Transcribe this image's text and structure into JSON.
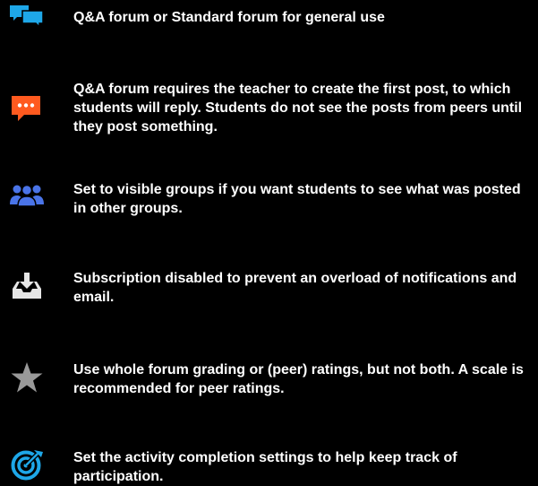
{
  "colors": {
    "background": "#000000",
    "text": "#ffffff",
    "icon_chat": "#1ea7e8",
    "icon_comment": "#ff5a1f",
    "icon_group": "#4a74e8",
    "icon_inbox": "#e6e6e6",
    "icon_star": "#999999",
    "icon_target": "#1ea7e8"
  },
  "items": [
    {
      "icon": "chat-bubbles-icon",
      "text": "Q&A forum or Standard forum for general use"
    },
    {
      "icon": "comment-dots-icon",
      "text": "Q&A forum requires the teacher to create the first post, to which students will reply. Students do not see the posts from peers until they post something."
    },
    {
      "icon": "users-group-icon",
      "text": "Set to visible groups if you want students to see what was posted in other groups."
    },
    {
      "icon": "inbox-download-icon",
      "text": "Subscription disabled to prevent an overload of notifications and email."
    },
    {
      "icon": "star-icon",
      "text": "Use whole forum grading or (peer) ratings, but not both. A scale is recommended for peer ratings."
    },
    {
      "icon": "target-icon",
      "text": "Set the activity completion settings to help keep track of participation."
    }
  ]
}
